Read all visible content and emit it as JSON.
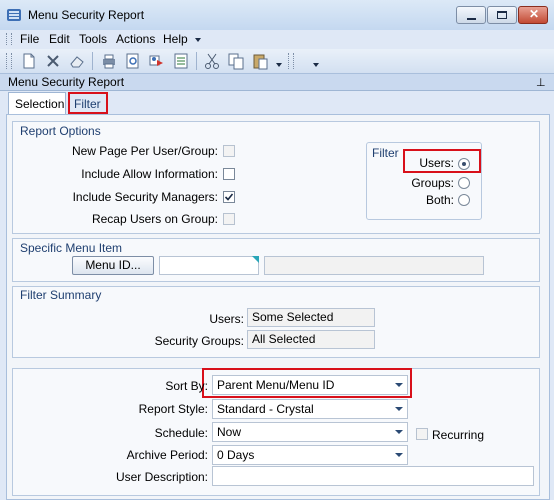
{
  "window": {
    "title": "Menu Security Report"
  },
  "menu": {
    "file": "File",
    "edit": "Edit",
    "tools": "Tools",
    "actions": "Actions",
    "help": "Help"
  },
  "report_header": {
    "title": "Menu Security Report"
  },
  "tabs": {
    "selection": "Selection",
    "filter": "Filter"
  },
  "report_options": {
    "title": "Report Options",
    "new_page_label": "New Page Per User/Group:",
    "include_allow_label": "Include Allow Information:",
    "include_managers_label": "Include Security Managers:",
    "include_managers_checked": true,
    "recap_label": "Recap Users on Group:"
  },
  "filter_box": {
    "title": "Filter",
    "users": "Users:",
    "groups": "Groups:",
    "both": "Both:",
    "selected": "users"
  },
  "specific_menu": {
    "title": "Specific Menu Item",
    "button": "Menu ID...",
    "menu_id_value": "",
    "description_value": ""
  },
  "filter_summary": {
    "title": "Filter Summary",
    "users_label": "Users:",
    "users_value": "Some Selected",
    "groups_label": "Security Groups:",
    "groups_value": "All Selected"
  },
  "settings": {
    "sort_label": "Sort By:",
    "sort_value": "Parent Menu/Menu ID",
    "style_label": "Report Style:",
    "style_value": "Standard - Crystal",
    "schedule_label": "Schedule:",
    "schedule_value": "Now",
    "recurring_label": "Recurring",
    "archive_label": "Archive Period:",
    "archive_value": "0 Days",
    "user_desc_label": "User Description:",
    "user_desc_value": ""
  }
}
